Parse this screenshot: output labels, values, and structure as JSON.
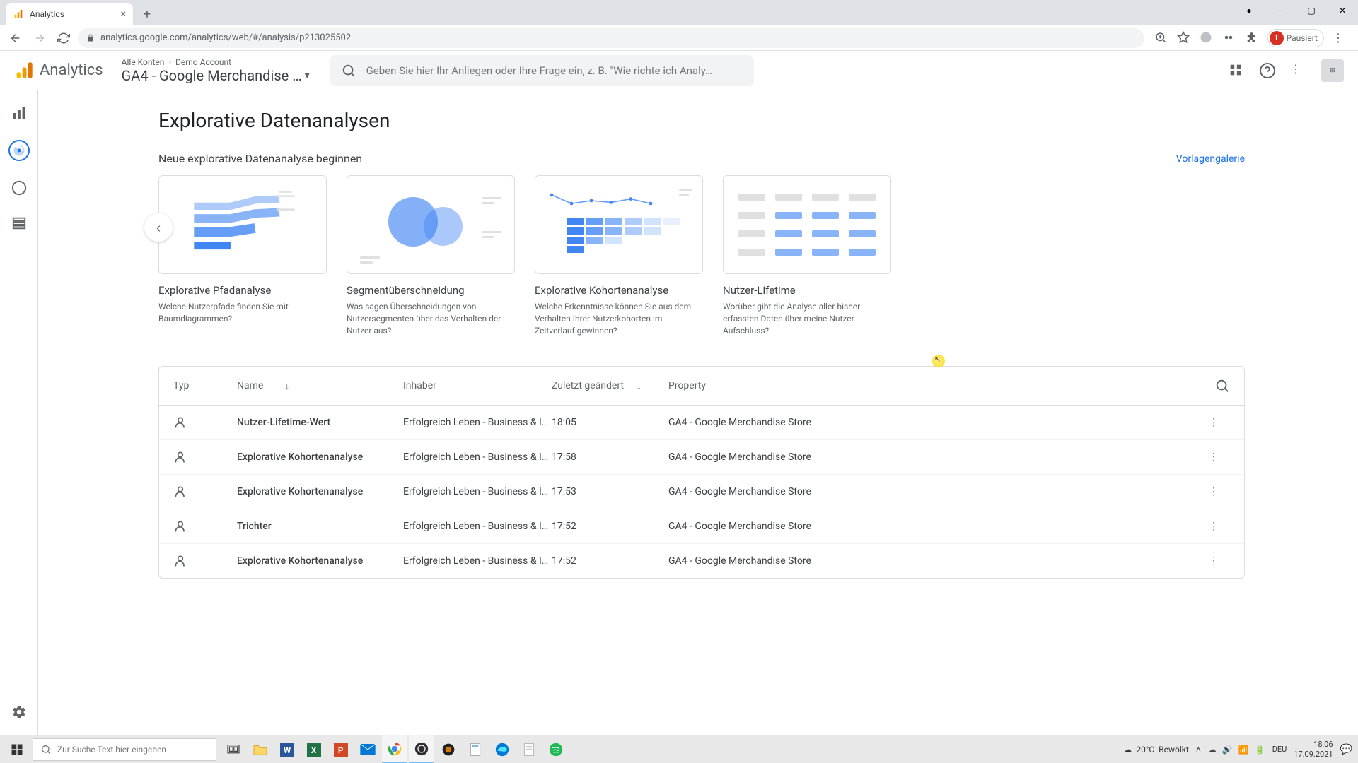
{
  "browser": {
    "tab_title": "Analytics",
    "url": "analytics.google.com/analytics/web/#/analysis/p213025502",
    "user_initial": "T",
    "user_status": "Pausiert"
  },
  "header": {
    "logo_text": "Analytics",
    "breadcrumb_all": "Alle Konten",
    "breadcrumb_account": "Demo Account",
    "property": "GA4 - Google Merchandise …",
    "search_placeholder": "Geben Sie hier Ihr Anliegen oder Ihre Frage ein, z. B. \"Wie richte ich Analy…"
  },
  "page": {
    "title": "Explorative Datenanalysen",
    "subtitle": "Neue explorative Datenanalyse beginnen",
    "gallery_link": "Vorlagengalerie"
  },
  "templates": [
    {
      "title": "Explorative Pfadanalyse",
      "desc": "Welche Nutzerpfade finden Sie mit Baumdiagrammen?"
    },
    {
      "title": "Segmentüberschneidung",
      "desc": "Was sagen Überschneidungen von Nutzersegmenten über das Verhalten der Nutzer aus?"
    },
    {
      "title": "Explorative Kohortenanalyse",
      "desc": "Welche Erkenntnisse können Sie aus dem Verhalten Ihrer Nutzerkohorten im Zeitverlauf gewinnen?"
    },
    {
      "title": "Nutzer-Lifetime",
      "desc": "Worüber gibt die Analyse aller bisher erfassten Daten über meine Nutzer Aufschluss?"
    }
  ],
  "table": {
    "columns": {
      "type": "Typ",
      "name": "Name",
      "owner": "Inhaber",
      "modified": "Zuletzt geändert",
      "property": "Property"
    },
    "rows": [
      {
        "name": "Nutzer-Lifetime-Wert",
        "owner": "Erfolgreich Leben - Business & I…",
        "modified": "18:05",
        "property": "GA4 - Google Merchandise Store"
      },
      {
        "name": "Explorative Kohortenanalyse",
        "owner": "Erfolgreich Leben - Business & I…",
        "modified": "17:58",
        "property": "GA4 - Google Merchandise Store"
      },
      {
        "name": "Explorative Kohortenanalyse",
        "owner": "Erfolgreich Leben - Business & I…",
        "modified": "17:53",
        "property": "GA4 - Google Merchandise Store"
      },
      {
        "name": "Trichter",
        "owner": "Erfolgreich Leben - Business & I…",
        "modified": "17:52",
        "property": "GA4 - Google Merchandise Store"
      },
      {
        "name": "Explorative Kohortenanalyse",
        "owner": "Erfolgreich Leben - Business & I…",
        "modified": "17:52",
        "property": "GA4 - Google Merchandise Store"
      }
    ]
  },
  "taskbar": {
    "search_placeholder": "Zur Suche Text hier eingeben",
    "weather_temp": "20°C",
    "weather_desc": "Bewölkt",
    "time": "18:06",
    "date": "17.09.2021",
    "lang": "DEU"
  }
}
